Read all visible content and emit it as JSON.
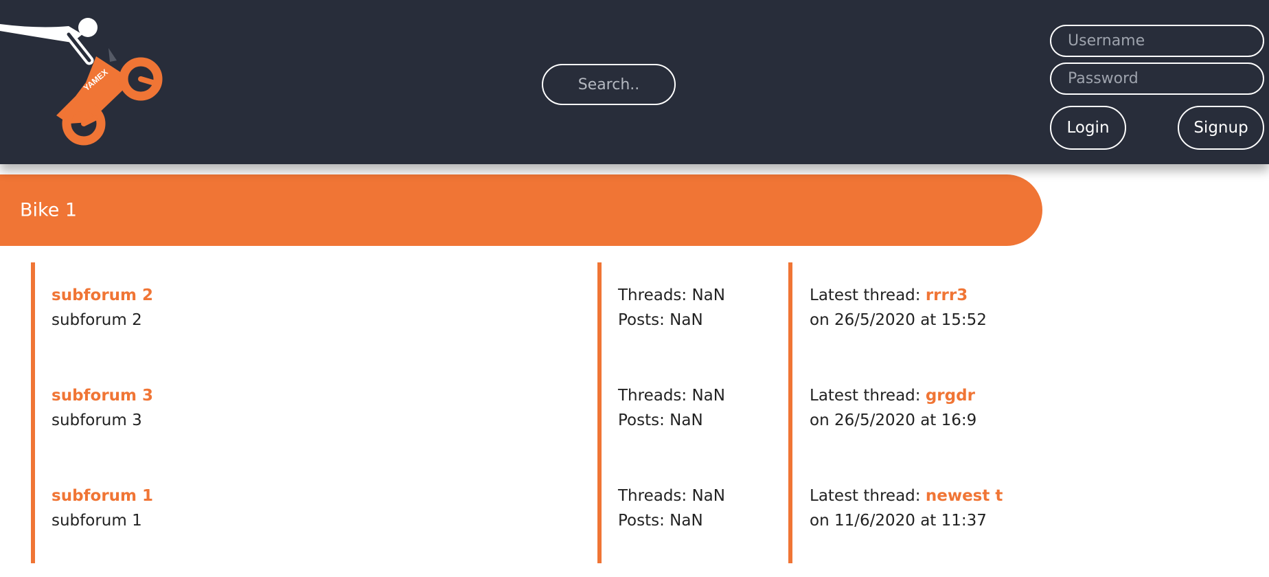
{
  "header": {
    "logo_text": "YAMEX",
    "search_placeholder": "Search..",
    "username_placeholder": "Username",
    "password_placeholder": "Password",
    "login_label": "Login",
    "signup_label": "Signup"
  },
  "category": {
    "title": "Bike 1"
  },
  "forums": [
    {
      "name": "subforum 2",
      "description": "subforum 2",
      "threads_label": "Threads: NaN",
      "posts_label": "Posts: NaN",
      "latest_prefix": "Latest thread: ",
      "latest_title": "rrrr3",
      "latest_date": "on 26/5/2020 at 15:52"
    },
    {
      "name": "subforum 3",
      "description": "subforum 3",
      "threads_label": "Threads: NaN",
      "posts_label": "Posts: NaN",
      "latest_prefix": "Latest thread: ",
      "latest_title": "grgdr",
      "latest_date": "on 26/5/2020 at 16:9"
    },
    {
      "name": "subforum 1",
      "description": "subforum 1",
      "threads_label": "Threads: NaN",
      "posts_label": "Posts: NaN",
      "latest_prefix": "Latest thread: ",
      "latest_title": "newest t",
      "latest_date": "on 11/6/2020 at 11:37"
    }
  ],
  "colors": {
    "header_bg": "#282d3a",
    "accent": "#f07535",
    "text": "#222222"
  }
}
